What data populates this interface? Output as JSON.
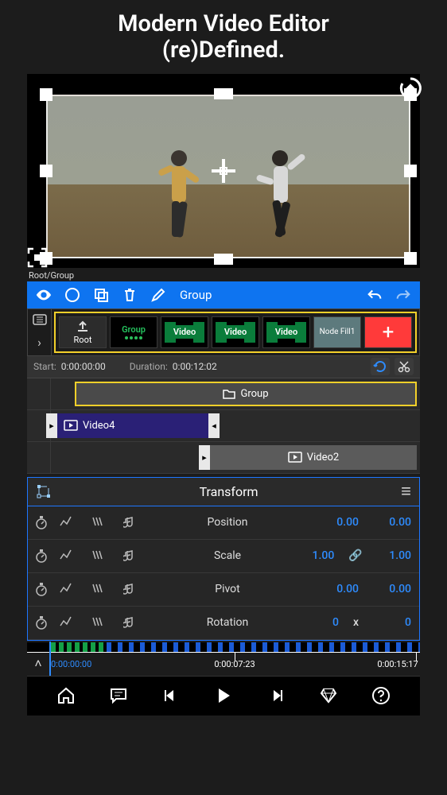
{
  "headline_l1": "Modern Video Editor",
  "headline_l2": "(re)Defined.",
  "breadcrumb": "Root/Group",
  "toolbar": {
    "group_label": "Group"
  },
  "layers": {
    "root": "Root",
    "group": "Group",
    "video": "Video",
    "fill": "Node Fill1",
    "add": "+"
  },
  "meta": {
    "start_label": "Start:",
    "start_value": "0:00:00:00",
    "duration_label": "Duration:",
    "duration_value": "0:00:12:02"
  },
  "clips": {
    "group": "Group",
    "video4": "Video4",
    "video2": "Video2"
  },
  "panel": {
    "title": "Transform",
    "rows": [
      {
        "name": "Position",
        "v1": "0.00",
        "mid": "",
        "v2": "0.00"
      },
      {
        "name": "Scale",
        "v1": "1.00",
        "mid": "link",
        "v2": "1.00"
      },
      {
        "name": "Pivot",
        "v1": "0.00",
        "mid": "",
        "v2": "0.00"
      },
      {
        "name": "Rotation",
        "v1": "0",
        "mid": "x",
        "v2": "0"
      }
    ]
  },
  "ruler": {
    "t0": "0:00:00:00",
    "t1": "0:00:07:23",
    "t2": "0:00:15:17"
  }
}
